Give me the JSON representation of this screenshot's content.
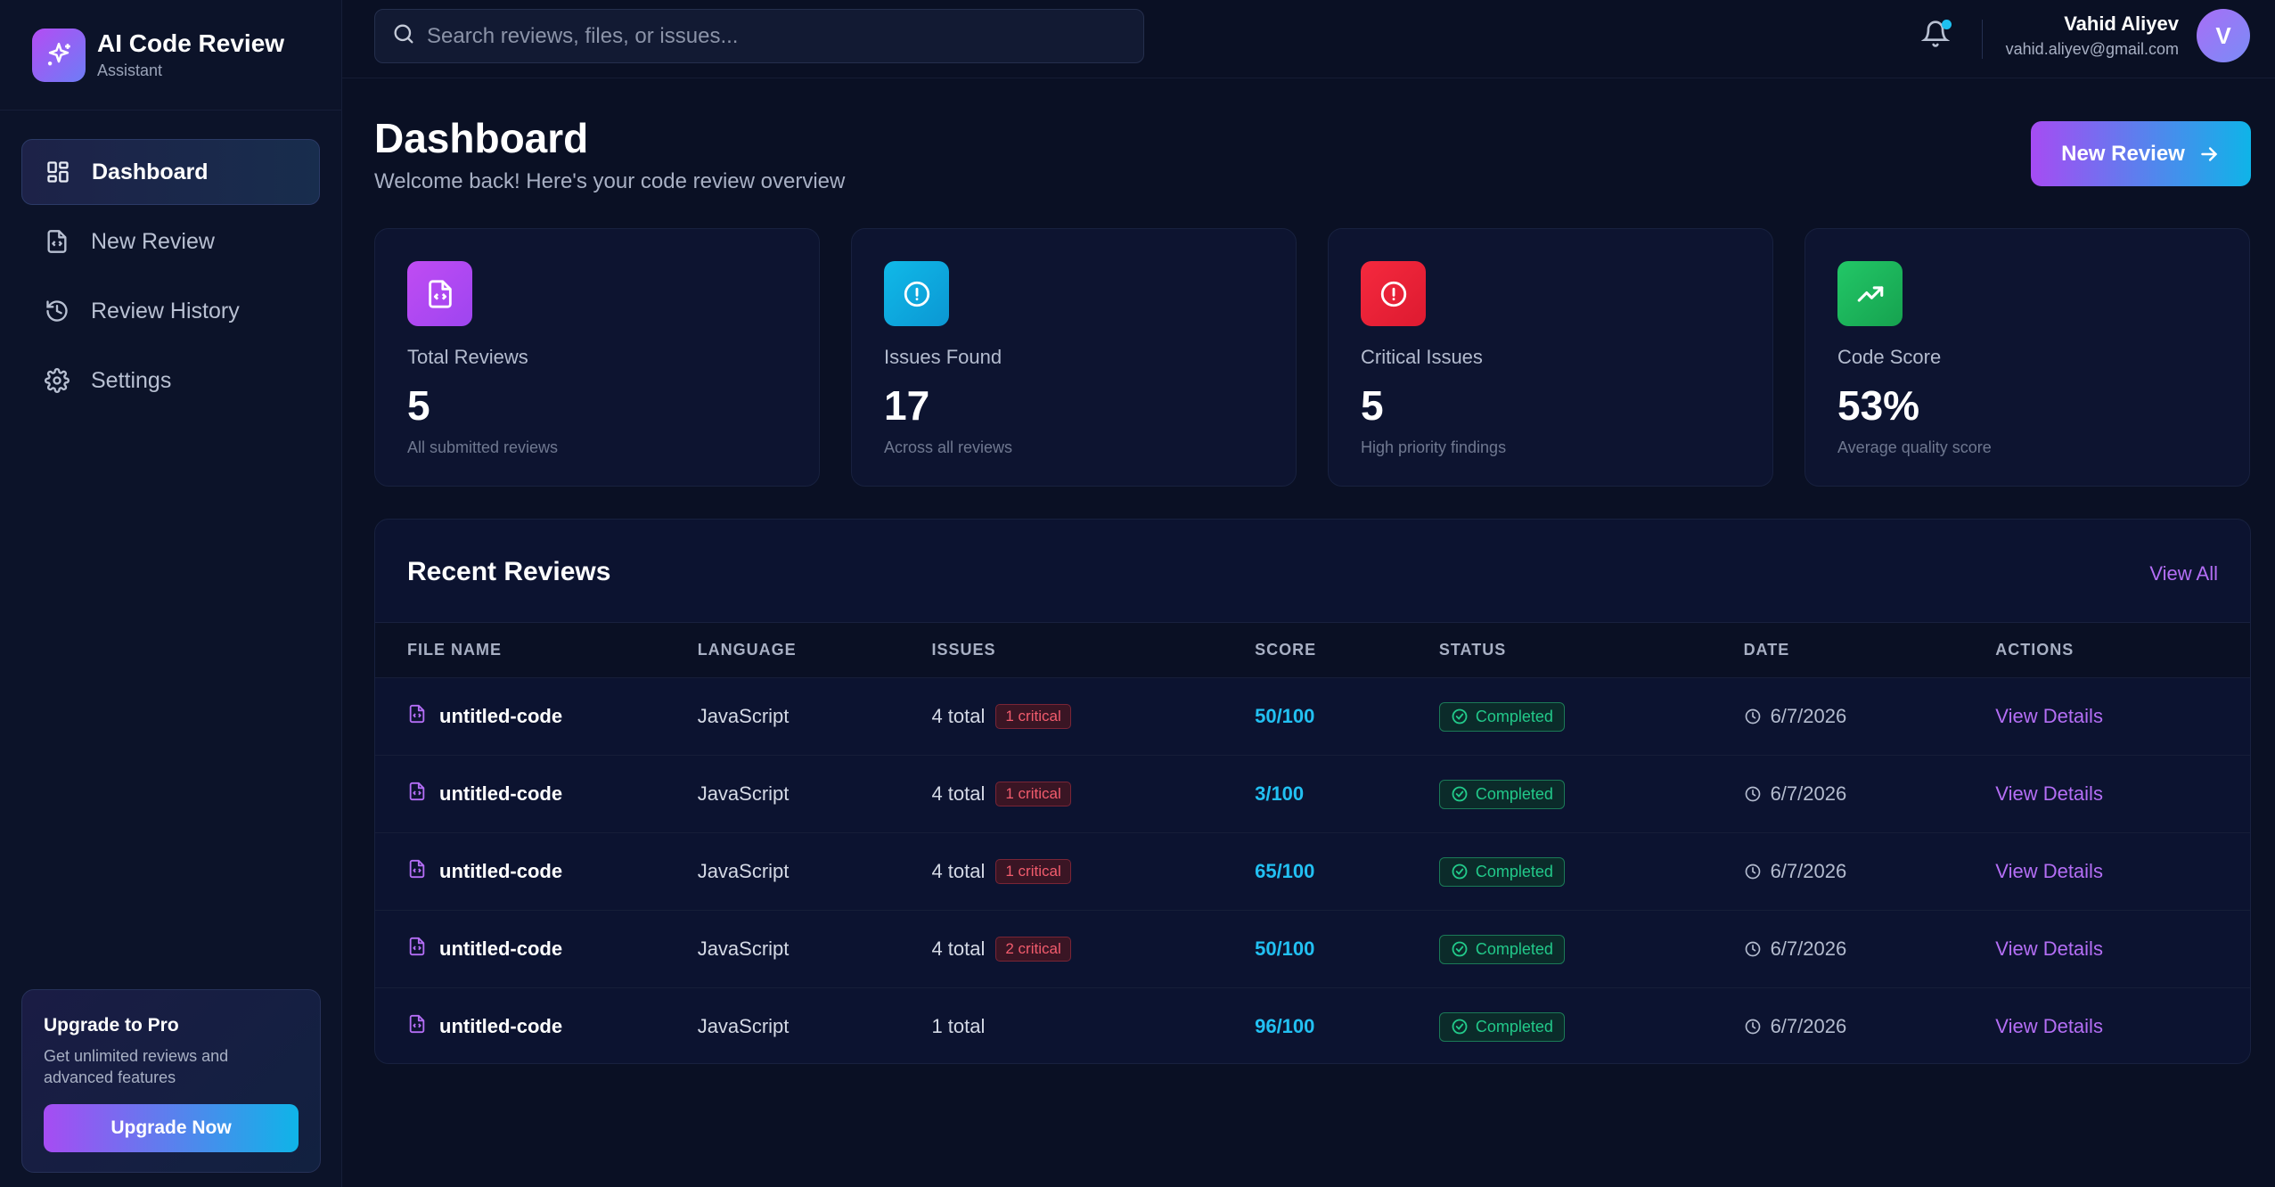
{
  "brand": {
    "title": "AI Code Review",
    "subtitle": "Assistant"
  },
  "nav": [
    {
      "label": "Dashboard",
      "icon": "grid-icon",
      "active": true
    },
    {
      "label": "New Review",
      "icon": "file-code-icon",
      "active": false
    },
    {
      "label": "Review History",
      "icon": "history-icon",
      "active": false
    },
    {
      "label": "Settings",
      "icon": "gear-icon",
      "active": false
    }
  ],
  "upgrade": {
    "title": "Upgrade to Pro",
    "text": "Get unlimited reviews and advanced features",
    "button": "Upgrade Now"
  },
  "search": {
    "placeholder": "Search reviews, files, or issues..."
  },
  "user": {
    "name": "Vahid Aliyev",
    "email": "vahid.aliyev@gmail.com",
    "initial": "V"
  },
  "page": {
    "title": "Dashboard",
    "subtitle": "Welcome back! Here's your code review overview",
    "new_review_button": "New Review"
  },
  "stats": [
    {
      "label": "Total Reviews",
      "value": "5",
      "note": "All submitted reviews",
      "icon": "file-code-icon",
      "color": "#b44cf3"
    },
    {
      "label": "Issues Found",
      "value": "17",
      "note": "Across all reviews",
      "icon": "alert-circle-icon",
      "color": "#0fb4e8"
    },
    {
      "label": "Critical Issues",
      "value": "5",
      "note": "High priority findings",
      "icon": "alert-circle-icon",
      "color": "#f2283e"
    },
    {
      "label": "Code Score",
      "value": "53%",
      "note": "Average quality score",
      "icon": "trending-up-icon",
      "color": "#1fc062"
    }
  ],
  "reviews": {
    "title": "Recent Reviews",
    "view_all": "View All",
    "columns": [
      "FILE NAME",
      "LANGUAGE",
      "ISSUES",
      "SCORE",
      "STATUS",
      "DATE",
      "ACTIONS"
    ],
    "rows": [
      {
        "file": "untitled-code",
        "language": "JavaScript",
        "issues": "4 total",
        "critical": "1 critical",
        "score": "50/100",
        "status": "Completed",
        "date": "6/7/2026",
        "action": "View Details"
      },
      {
        "file": "untitled-code",
        "language": "JavaScript",
        "issues": "4 total",
        "critical": "1 critical",
        "score": "3/100",
        "status": "Completed",
        "date": "6/7/2026",
        "action": "View Details"
      },
      {
        "file": "untitled-code",
        "language": "JavaScript",
        "issues": "4 total",
        "critical": "1 critical",
        "score": "65/100",
        "status": "Completed",
        "date": "6/7/2026",
        "action": "View Details"
      },
      {
        "file": "untitled-code",
        "language": "JavaScript",
        "issues": "4 total",
        "critical": "2 critical",
        "score": "50/100",
        "status": "Completed",
        "date": "6/7/2026",
        "action": "View Details"
      },
      {
        "file": "untitled-code",
        "language": "JavaScript",
        "issues": "1 total",
        "critical": "",
        "score": "96/100",
        "status": "Completed",
        "date": "6/7/2026",
        "action": "View Details"
      }
    ]
  },
  "colors": {
    "background": "#0a1024",
    "accent_purple": "#a64cf3",
    "accent_cyan": "#0fb4e8",
    "score": "#22c0f2",
    "success": "#22c98a",
    "critical": "#f25c6d"
  }
}
